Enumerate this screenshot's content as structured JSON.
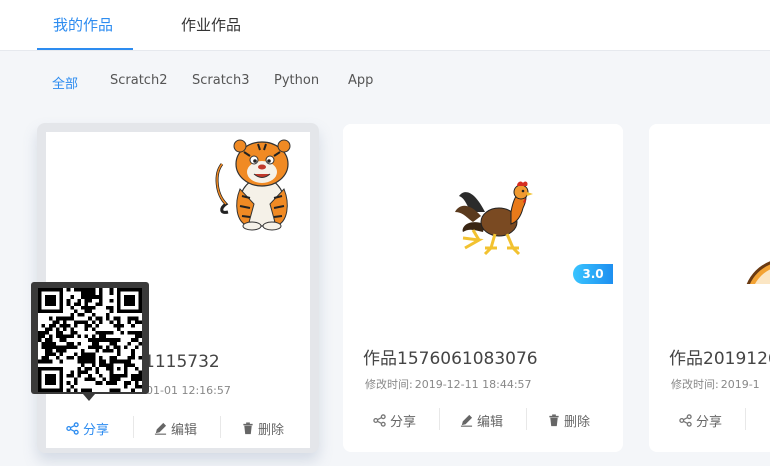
{
  "tabs": [
    {
      "label": "我的作品",
      "active": true
    },
    {
      "label": "作业作品",
      "active": false
    }
  ],
  "filters": [
    {
      "label": "全部",
      "active": true
    },
    {
      "label": "Scratch2",
      "active": false
    },
    {
      "label": "Scratch3",
      "active": false
    },
    {
      "label": "Python",
      "active": false
    },
    {
      "label": "App",
      "active": false
    }
  ],
  "actions": {
    "share": "分享",
    "edit": "编辑",
    "delete": "删除"
  },
  "mtime_label": "修改时间:",
  "cards": [
    {
      "title": "1115732",
      "mtime": "01-01 12:16:57",
      "thumbnail": "tiger",
      "badge": null
    },
    {
      "title": "作品1576061083076",
      "mtime": "2019-12-11 18:44:57",
      "thumbnail": "rooster",
      "badge": "3.0"
    },
    {
      "title": "作品2019126",
      "mtime": "2019-1",
      "thumbnail": "orange-circle",
      "badge": null
    }
  ],
  "colors": {
    "accent": "#2d8cf0",
    "badge": "#1e8ff0",
    "background": "#f4f6f9"
  }
}
